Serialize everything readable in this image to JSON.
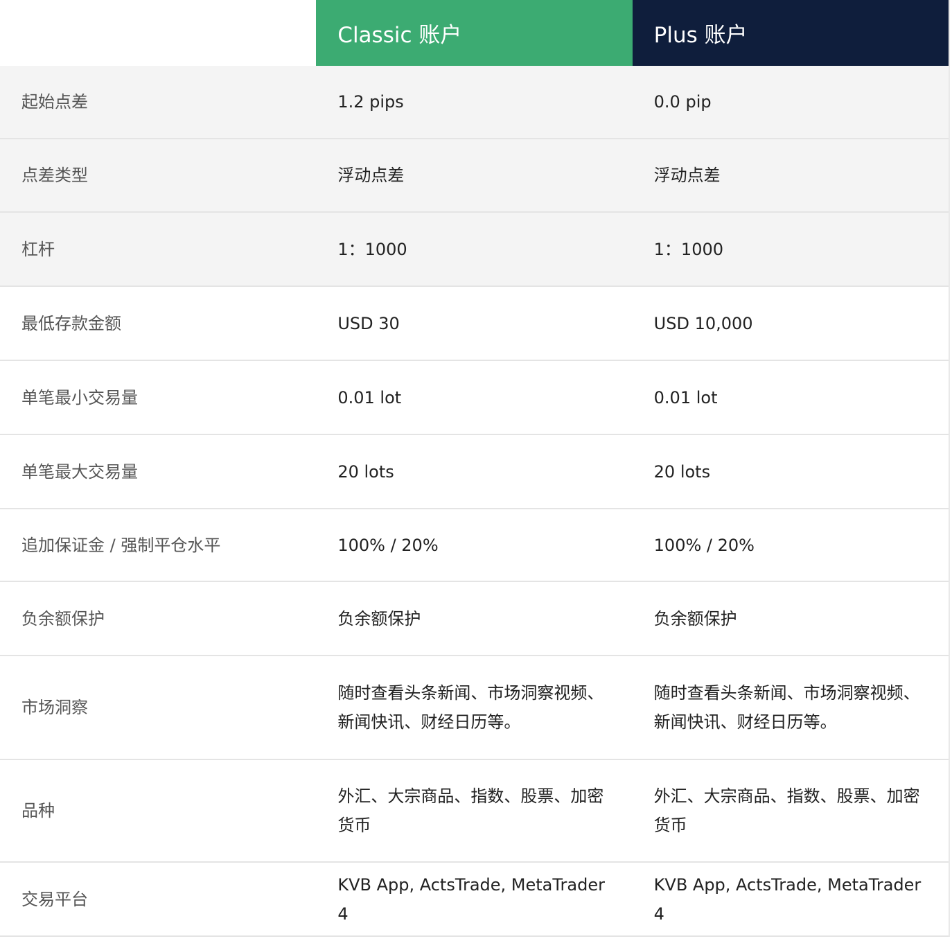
{
  "header": {
    "classic": "Classic 账户",
    "plus": "Plus 账户"
  },
  "colors": {
    "classic_header": "#3cab72",
    "plus_header": "#0f1e3c",
    "shaded_row": "#f4f4f4"
  },
  "rows": [
    {
      "label": "起始点差",
      "classic": "1.2 pips",
      "plus": "0.0 pip"
    },
    {
      "label": "点差类型",
      "classic": "浮动点差",
      "plus": "浮动点差"
    },
    {
      "label": "杠杆",
      "classic": "1：1000",
      "plus": "1：1000"
    },
    {
      "label": "最低存款金额",
      "classic": "USD 30",
      "plus": "USD 10,000"
    },
    {
      "label": "单笔最小交易量",
      "classic": "0.01 lot",
      "plus": "0.01 lot"
    },
    {
      "label": "单笔最大交易量",
      "classic": "20 lots",
      "plus": "20 lots"
    },
    {
      "label": "追加保证金 / 强制平仓水平",
      "classic": "100% / 20%",
      "plus": "100% / 20%"
    },
    {
      "label": "负余额保护",
      "classic": "负余额保护",
      "plus": "负余额保护"
    },
    {
      "label": "市场洞察",
      "classic": "随时查看头条新闻、市场洞察视频、新闻快讯、财经日历等。",
      "plus": "随时查看头条新闻、市场洞察视频、新闻快讯、财经日历等。"
    },
    {
      "label": "品种",
      "classic": "外汇、大宗商品、指数、股票、加密货币",
      "plus": "外汇、大宗商品、指数、股票、加密货币"
    },
    {
      "label": "交易平台",
      "classic": "KVB App, ActsTrade, MetaTrader 4",
      "plus": "KVB App, ActsTrade, MetaTrader 4"
    }
  ]
}
